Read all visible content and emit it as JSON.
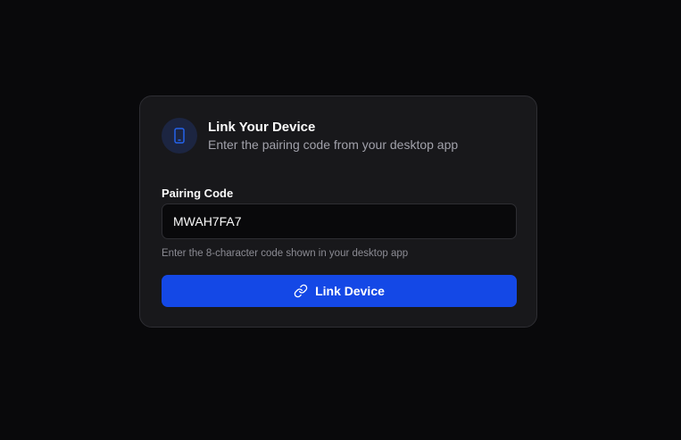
{
  "card": {
    "icon": "smartphone-icon",
    "title": "Link Your Device",
    "subtitle": "Enter the pairing code from your desktop app"
  },
  "form": {
    "label": "Pairing Code",
    "value": "MWAH7FA7",
    "hint": "Enter the 8-character code shown in your desktop app"
  },
  "button": {
    "icon": "link-icon",
    "label": "Link Device"
  },
  "colors": {
    "background": "#09090b",
    "card": "#18181b",
    "accent": "#1448e6"
  }
}
